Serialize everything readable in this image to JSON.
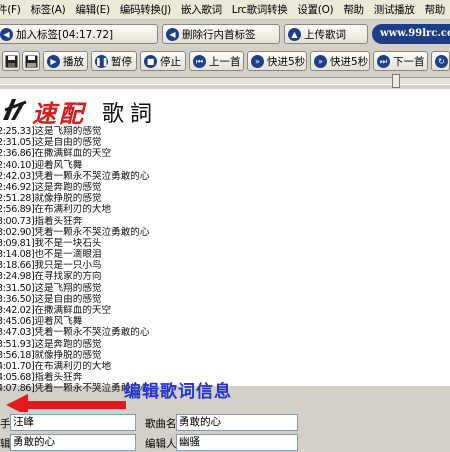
{
  "menu": [
    "件(F)",
    "标签(A)",
    "编辑(E)",
    "编码转换(J)",
    "嵌入歌词",
    "Lrc歌词转换",
    "设置(O)",
    "帮助",
    "测试播放",
    "帮助"
  ],
  "toolbar": {
    "add_tag_label": "加入标签[04:17.72]",
    "delete_tag_label": "删除行内首标签",
    "upload_label": "上传歌词",
    "site_label": "www.99lrc.com"
  },
  "playback": {
    "play": "播放",
    "pause": "暂停",
    "stop": "停止",
    "prev": "上一首",
    "fast_forward": "快进5秒",
    "fast_forward_2": "快进5秒",
    "next": "下一首",
    "extra": "循"
  },
  "logo": {
    "red_text": "速配",
    "black_text": "歌詞"
  },
  "lyrics": [
    {
      "time": "2:25.33]",
      "text": "这是飞翔的感觉"
    },
    {
      "time": "2:31.05]",
      "text": "这是自由的感觉"
    },
    {
      "time": "2:36.86]",
      "text": "在撒满鲜血的天空"
    },
    {
      "time": "2:40.10]",
      "text": "迎着风飞舞"
    },
    {
      "time": "2:42.03]",
      "text": "凭着一颗永不哭泣勇敢的心"
    },
    {
      "time": "2:46.92]",
      "text": "这是奔跑的感觉"
    },
    {
      "time": "2:51.28]",
      "text": "就像挣脱的感觉"
    },
    {
      "time": "2:56.89]",
      "text": "在布满利刃的大地"
    },
    {
      "time": "3:00.73]",
      "text": "指着头狂奔"
    },
    {
      "time": "3:02.90]",
      "text": "凭着一颗永不哭泣勇敢的心"
    },
    {
      "time": "3:09.81]",
      "text": "我不是一块石头"
    },
    {
      "time": "3:14.08]",
      "text": "也不是一滴眼泪"
    },
    {
      "time": "3:18.66]",
      "text": "我只是一只小鸟"
    },
    {
      "time": "3:24.98]",
      "text": "在寻找家的方向"
    },
    {
      "time": "3:31.50]",
      "text": "这是飞翔的感觉"
    },
    {
      "time": "3:36.50]",
      "text": "这是自由的感觉"
    },
    {
      "time": "3:42.02]",
      "text": "在撒满鲜血的天空"
    },
    {
      "time": "3:45.06]",
      "text": "迎着风飞舞"
    },
    {
      "time": "3:47.03]",
      "text": "凭着一颗永不哭泣勇敢的心"
    },
    {
      "time": "3:51.93]",
      "text": "这是奔跑的感觉"
    },
    {
      "time": "3:56.18]",
      "text": "就像挣脱的感觉"
    },
    {
      "time": "4:01.70]",
      "text": "在布满利刃的大地"
    },
    {
      "time": "4:05.68]",
      "text": "指着头狂奔"
    },
    {
      "time": "4:07.86]",
      "text": "凭着一颗永不哭泣勇敢的心"
    }
  ],
  "annotation": "编辑歌词信息",
  "info": {
    "singer_label": "手",
    "singer_value": "汪峰",
    "song_label": "歌曲名",
    "song_value": "勇敢的心",
    "album_label": "辑",
    "album_value": "勇敢的心",
    "editor_label": "编辑人",
    "editor_value": "幽骚"
  },
  "colors": {
    "accent_blue": "#1c3f8c",
    "logo_red": "#d81c1c",
    "annotation_blue": "#2233dd",
    "arrow_red": "#e01b1b"
  }
}
